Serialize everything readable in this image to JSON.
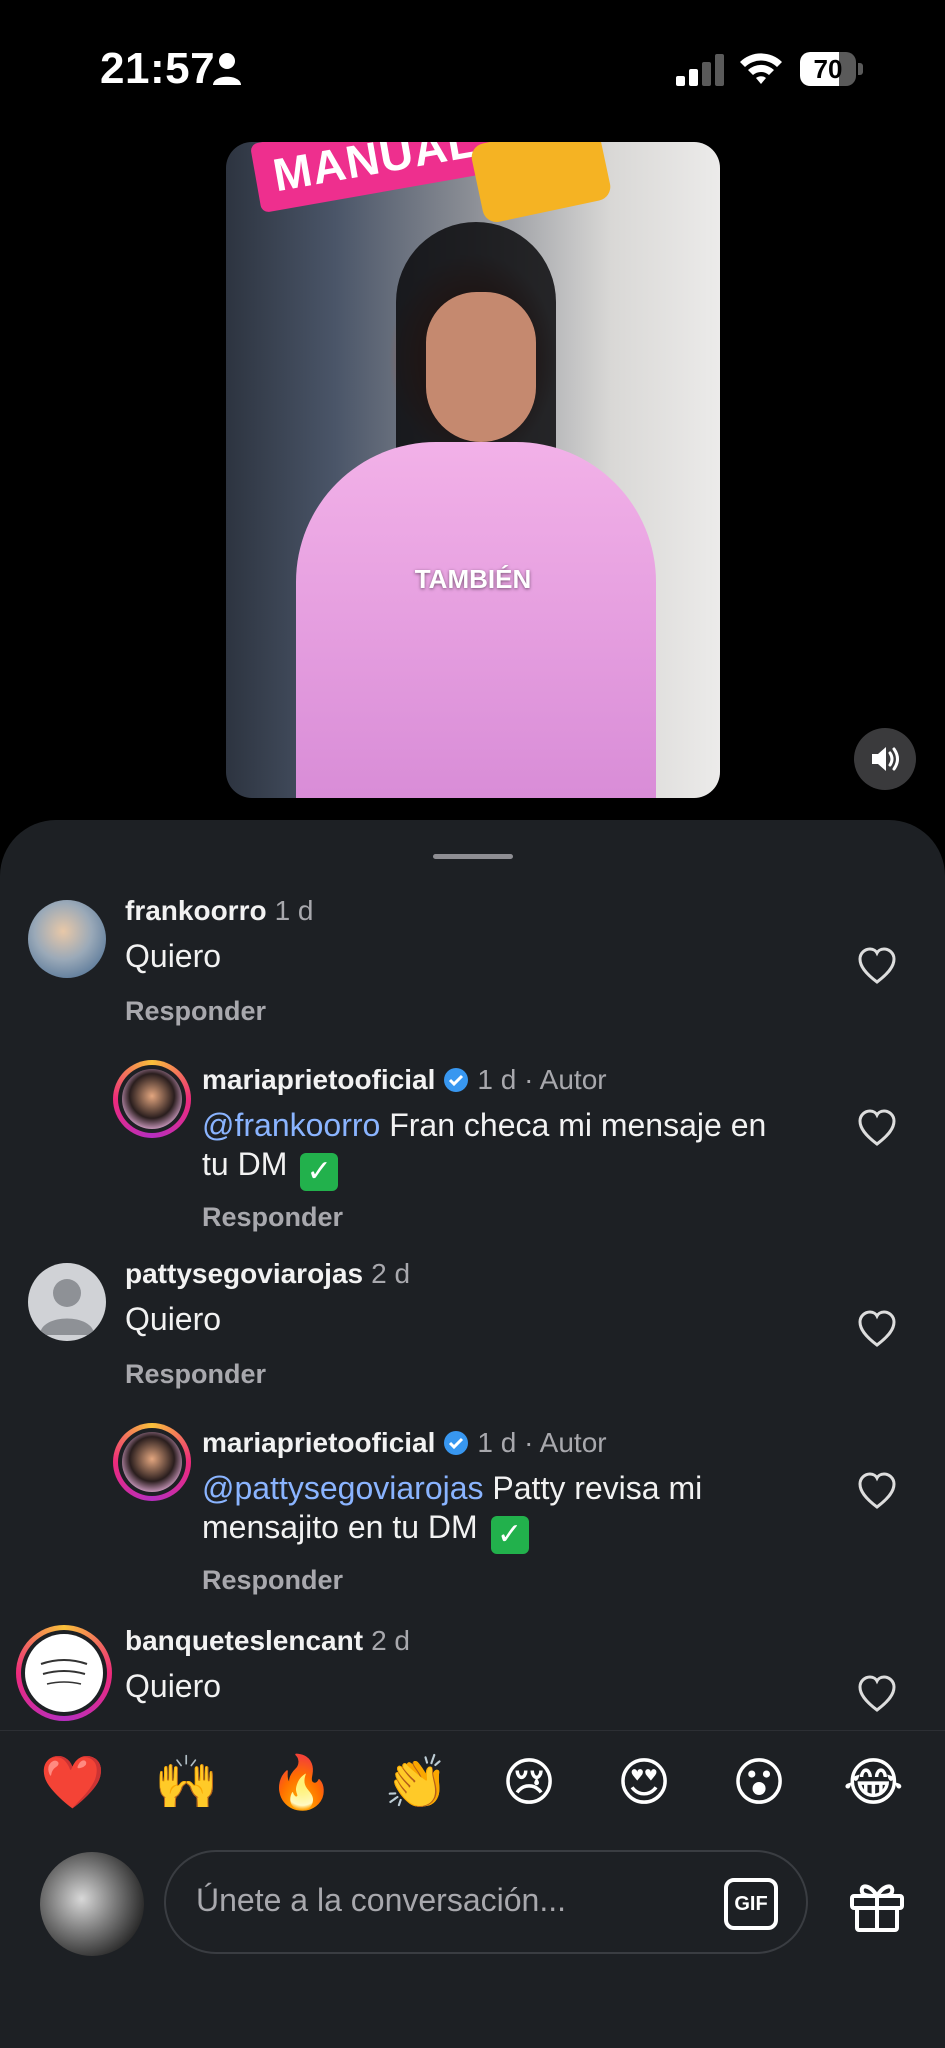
{
  "status_bar": {
    "time": "21:57",
    "battery": "70",
    "battery_level_percent": 70
  },
  "video": {
    "banner_text": "MANUAL",
    "caption": "TAMBIÉN"
  },
  "comments": [
    {
      "username": "frankoorro",
      "meta": "1 d",
      "text": "Quiero",
      "reply_label": "Responder"
    },
    {
      "username": "mariaprietooficial",
      "meta": "1 d · Autor",
      "mention": "@frankoorro",
      "text": " Fran checa mi mensaje en",
      "text2": "tu DM",
      "reply_label": "Responder"
    },
    {
      "username": "pattysegoviarojas",
      "meta": "2 d",
      "text": "Quiero",
      "reply_label": "Responder"
    },
    {
      "username": "mariaprietooficial",
      "meta": "1 d · Autor",
      "mention": "@pattysegoviarojas",
      "text": " Patty revisa mi",
      "text2": "mensajito en tu DM",
      "reply_label": "Responder"
    },
    {
      "username": "banqueteslencant",
      "meta": "2 d",
      "text": "Quiero"
    }
  ],
  "emoji_bar": [
    "❤️",
    "🙌",
    "🔥",
    "👏",
    "😢",
    "😍",
    "😮",
    "😂"
  ],
  "input": {
    "placeholder": "Únete a la conversación...",
    "gif_label": "GIF"
  },
  "icons": [
    "person-icon",
    "signal-icon",
    "wifi-icon",
    "volume-icon",
    "heart-icon",
    "verified-icon",
    "gif-icon",
    "gift-icon"
  ]
}
